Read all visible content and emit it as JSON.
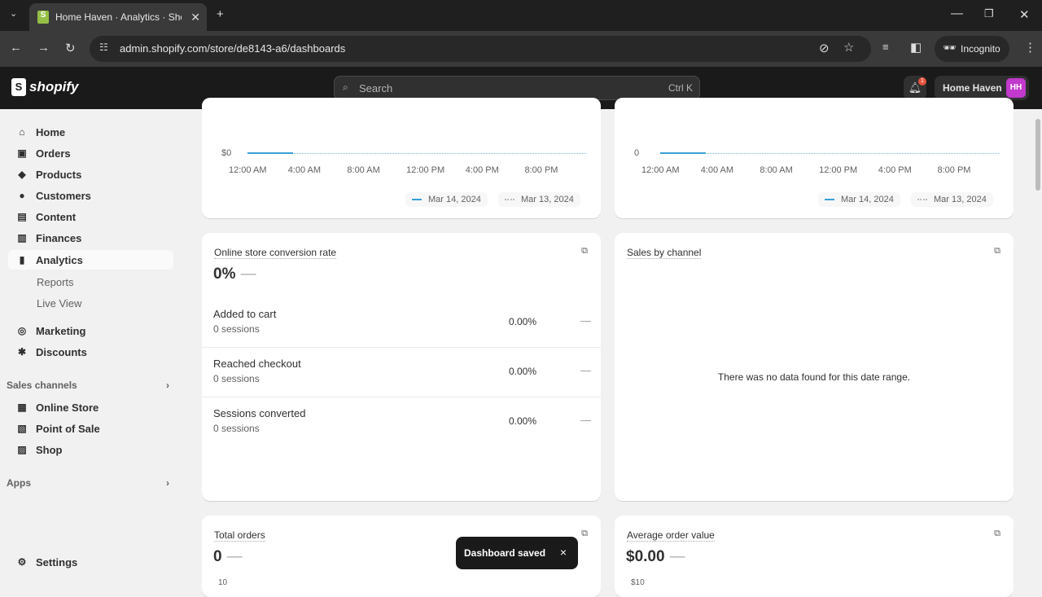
{
  "browser": {
    "tab_title": "Home Haven · Analytics · Shopify",
    "url": "admin.shopify.com/store/de8143-a6/dashboards",
    "profile": "Incognito"
  },
  "header": {
    "brand": "shopify",
    "search_placeholder": "Search",
    "search_shortcut": "Ctrl K",
    "notification_count": "1",
    "store_name": "Home Haven",
    "avatar_initials": "HH",
    "avatar_color": "#c13acd"
  },
  "sidebar": {
    "items": [
      {
        "label": "Home",
        "icon": "home-icon"
      },
      {
        "label": "Orders",
        "icon": "orders-icon"
      },
      {
        "label": "Products",
        "icon": "tag-icon"
      },
      {
        "label": "Customers",
        "icon": "person-icon"
      },
      {
        "label": "Content",
        "icon": "content-icon"
      },
      {
        "label": "Finances",
        "icon": "bank-icon"
      },
      {
        "label": "Analytics",
        "icon": "bar-chart-icon",
        "active": true
      },
      {
        "label": "Reports"
      },
      {
        "label": "Live View"
      },
      {
        "label": "Marketing",
        "icon": "target-icon"
      },
      {
        "label": "Discounts",
        "icon": "discount-icon"
      }
    ],
    "sales_channels_heading": "Sales channels",
    "channels": [
      {
        "label": "Online Store"
      },
      {
        "label": "Point of Sale"
      },
      {
        "label": "Shop"
      }
    ],
    "apps_heading": "Apps",
    "settings": "Settings"
  },
  "chart_data": [
    {
      "type": "line",
      "y_ticks": [
        "$0"
      ],
      "x_ticks": [
        "12:00 AM",
        "4:00 AM",
        "8:00 AM",
        "12:00 PM",
        "4:00 PM",
        "8:00 PM"
      ],
      "series": [
        {
          "name": "Mar 14, 2024",
          "values": [
            0,
            0
          ]
        },
        {
          "name": "Mar 13, 2024",
          "values": [
            0,
            0,
            0,
            0,
            0,
            0,
            0
          ]
        }
      ]
    },
    {
      "type": "line",
      "y_ticks": [
        "0"
      ],
      "x_ticks": [
        "12:00 AM",
        "4:00 AM",
        "8:00 AM",
        "12:00 PM",
        "4:00 PM",
        "8:00 PM"
      ],
      "series": [
        {
          "name": "Mar 14, 2024",
          "values": [
            0,
            0
          ]
        },
        {
          "name": "Mar 13, 2024",
          "values": [
            0,
            0,
            0,
            0,
            0,
            0,
            0
          ]
        }
      ]
    }
  ],
  "conversion": {
    "title": "Online store conversion rate",
    "value": "0%",
    "change": "—",
    "rows": [
      {
        "label": "Added to cart",
        "sessions": "0 sessions",
        "pct": "0.00%",
        "change": "—"
      },
      {
        "label": "Reached checkout",
        "sessions": "0 sessions",
        "pct": "0.00%",
        "change": "—"
      },
      {
        "label": "Sessions converted",
        "sessions": "0 sessions",
        "pct": "0.00%",
        "change": "—"
      }
    ]
  },
  "sales_by_channel": {
    "title": "Sales by channel",
    "empty": "There was no data found for this date range."
  },
  "total_orders": {
    "title": "Total orders",
    "value": "0",
    "change": "—",
    "y_top": "10"
  },
  "aov": {
    "title": "Average order value",
    "value": "$0.00",
    "change": "—",
    "y_top": "$10"
  },
  "toast": {
    "message": "Dashboard saved",
    "close": "×"
  }
}
